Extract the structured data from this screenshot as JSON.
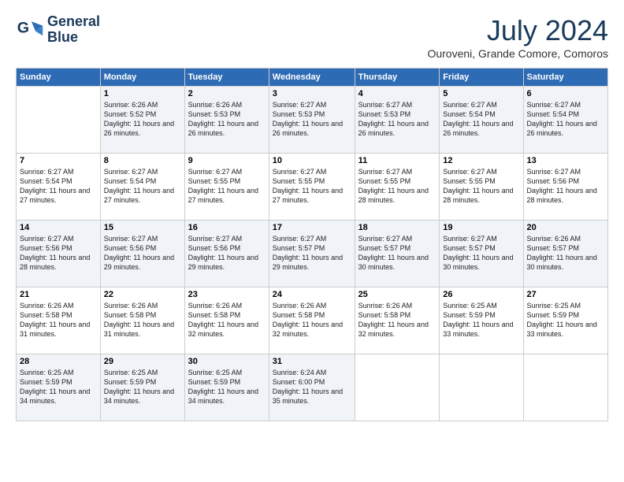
{
  "logo": {
    "line1": "General",
    "line2": "Blue"
  },
  "title": "July 2024",
  "location": "Ouroveni, Grande Comore, Comoros",
  "days_of_week": [
    "Sunday",
    "Monday",
    "Tuesday",
    "Wednesday",
    "Thursday",
    "Friday",
    "Saturday"
  ],
  "weeks": [
    [
      {
        "day": "",
        "empty": true
      },
      {
        "day": "1",
        "sunrise": "6:26 AM",
        "sunset": "5:52 PM",
        "daylight": "11 hours and 26 minutes."
      },
      {
        "day": "2",
        "sunrise": "6:26 AM",
        "sunset": "5:53 PM",
        "daylight": "11 hours and 26 minutes."
      },
      {
        "day": "3",
        "sunrise": "6:27 AM",
        "sunset": "5:53 PM",
        "daylight": "11 hours and 26 minutes."
      },
      {
        "day": "4",
        "sunrise": "6:27 AM",
        "sunset": "5:53 PM",
        "daylight": "11 hours and 26 minutes."
      },
      {
        "day": "5",
        "sunrise": "6:27 AM",
        "sunset": "5:54 PM",
        "daylight": "11 hours and 26 minutes."
      },
      {
        "day": "6",
        "sunrise": "6:27 AM",
        "sunset": "5:54 PM",
        "daylight": "11 hours and 26 minutes."
      }
    ],
    [
      {
        "day": "7",
        "sunrise": "6:27 AM",
        "sunset": "5:54 PM",
        "daylight": "11 hours and 27 minutes."
      },
      {
        "day": "8",
        "sunrise": "6:27 AM",
        "sunset": "5:54 PM",
        "daylight": "11 hours and 27 minutes."
      },
      {
        "day": "9",
        "sunrise": "6:27 AM",
        "sunset": "5:55 PM",
        "daylight": "11 hours and 27 minutes."
      },
      {
        "day": "10",
        "sunrise": "6:27 AM",
        "sunset": "5:55 PM",
        "daylight": "11 hours and 27 minutes."
      },
      {
        "day": "11",
        "sunrise": "6:27 AM",
        "sunset": "5:55 PM",
        "daylight": "11 hours and 28 minutes."
      },
      {
        "day": "12",
        "sunrise": "6:27 AM",
        "sunset": "5:55 PM",
        "daylight": "11 hours and 28 minutes."
      },
      {
        "day": "13",
        "sunrise": "6:27 AM",
        "sunset": "5:56 PM",
        "daylight": "11 hours and 28 minutes."
      }
    ],
    [
      {
        "day": "14",
        "sunrise": "6:27 AM",
        "sunset": "5:56 PM",
        "daylight": "11 hours and 28 minutes."
      },
      {
        "day": "15",
        "sunrise": "6:27 AM",
        "sunset": "5:56 PM",
        "daylight": "11 hours and 29 minutes."
      },
      {
        "day": "16",
        "sunrise": "6:27 AM",
        "sunset": "5:56 PM",
        "daylight": "11 hours and 29 minutes."
      },
      {
        "day": "17",
        "sunrise": "6:27 AM",
        "sunset": "5:57 PM",
        "daylight": "11 hours and 29 minutes."
      },
      {
        "day": "18",
        "sunrise": "6:27 AM",
        "sunset": "5:57 PM",
        "daylight": "11 hours and 30 minutes."
      },
      {
        "day": "19",
        "sunrise": "6:27 AM",
        "sunset": "5:57 PM",
        "daylight": "11 hours and 30 minutes."
      },
      {
        "day": "20",
        "sunrise": "6:26 AM",
        "sunset": "5:57 PM",
        "daylight": "11 hours and 30 minutes."
      }
    ],
    [
      {
        "day": "21",
        "sunrise": "6:26 AM",
        "sunset": "5:58 PM",
        "daylight": "11 hours and 31 minutes."
      },
      {
        "day": "22",
        "sunrise": "6:26 AM",
        "sunset": "5:58 PM",
        "daylight": "11 hours and 31 minutes."
      },
      {
        "day": "23",
        "sunrise": "6:26 AM",
        "sunset": "5:58 PM",
        "daylight": "11 hours and 32 minutes."
      },
      {
        "day": "24",
        "sunrise": "6:26 AM",
        "sunset": "5:58 PM",
        "daylight": "11 hours and 32 minutes."
      },
      {
        "day": "25",
        "sunrise": "6:26 AM",
        "sunset": "5:58 PM",
        "daylight": "11 hours and 32 minutes."
      },
      {
        "day": "26",
        "sunrise": "6:25 AM",
        "sunset": "5:59 PM",
        "daylight": "11 hours and 33 minutes."
      },
      {
        "day": "27",
        "sunrise": "6:25 AM",
        "sunset": "5:59 PM",
        "daylight": "11 hours and 33 minutes."
      }
    ],
    [
      {
        "day": "28",
        "sunrise": "6:25 AM",
        "sunset": "5:59 PM",
        "daylight": "11 hours and 34 minutes."
      },
      {
        "day": "29",
        "sunrise": "6:25 AM",
        "sunset": "5:59 PM",
        "daylight": "11 hours and 34 minutes."
      },
      {
        "day": "30",
        "sunrise": "6:25 AM",
        "sunset": "5:59 PM",
        "daylight": "11 hours and 34 minutes."
      },
      {
        "day": "31",
        "sunrise": "6:24 AM",
        "sunset": "6:00 PM",
        "daylight": "11 hours and 35 minutes."
      },
      {
        "day": "",
        "empty": true
      },
      {
        "day": "",
        "empty": true
      },
      {
        "day": "",
        "empty": true
      }
    ]
  ]
}
